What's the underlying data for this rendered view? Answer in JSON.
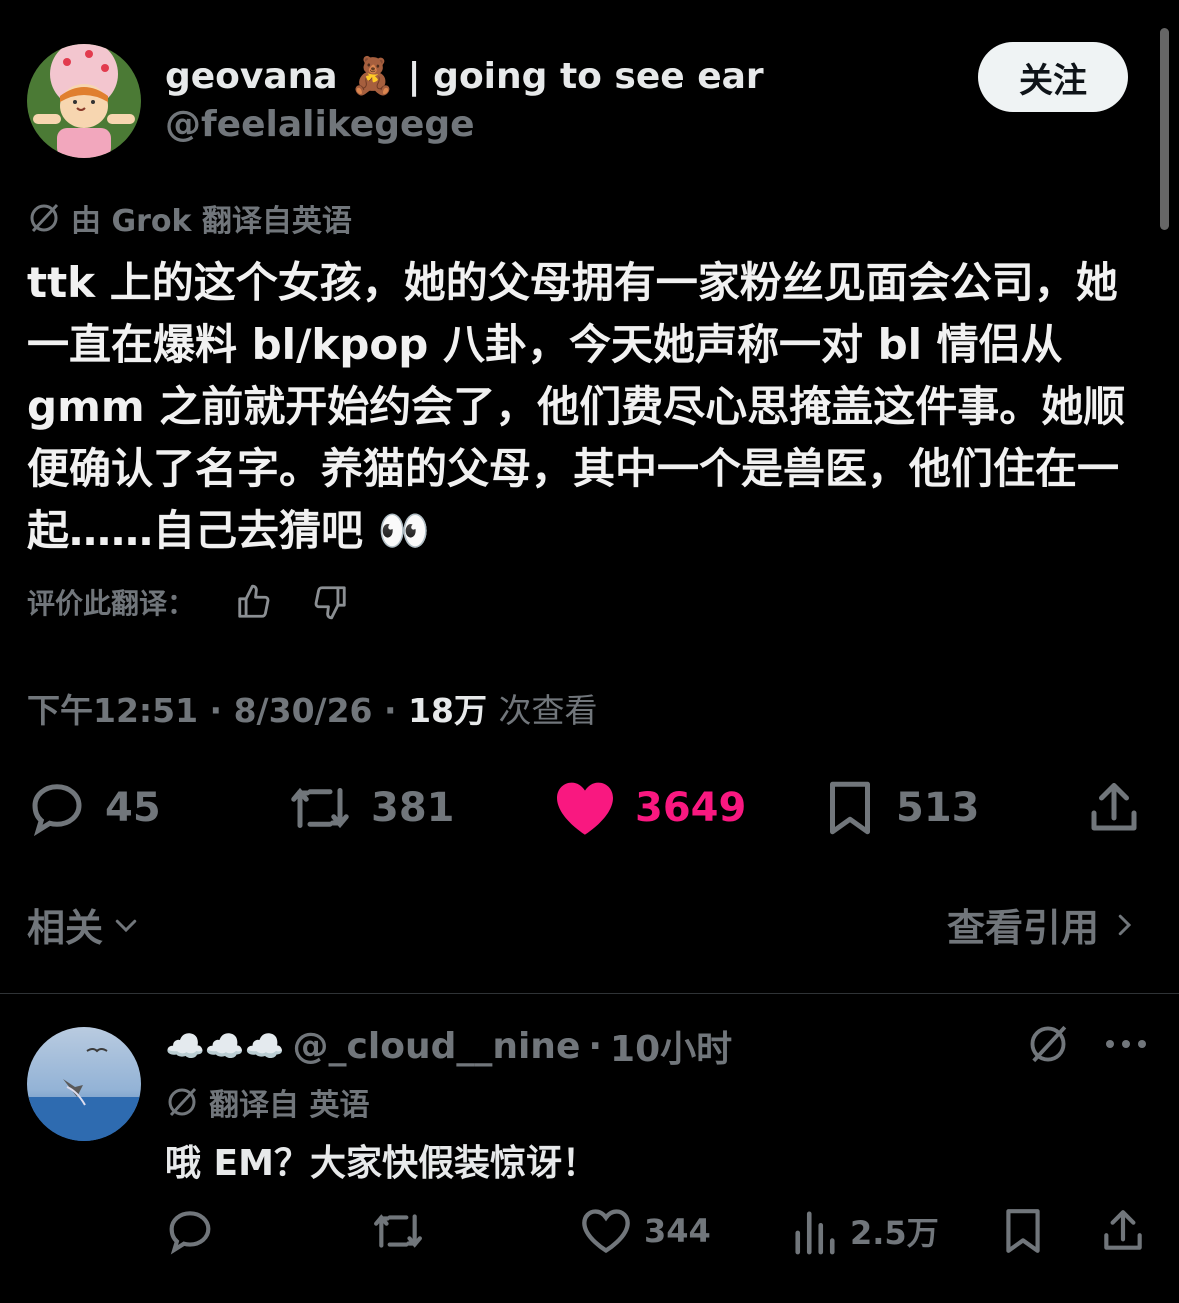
{
  "tweet": {
    "display_name": "geovana 🧸 | going to see ear",
    "handle": "@feelalikegege",
    "follow_label": "关注",
    "translation_note": "由 Grok 翻译自英语",
    "body": "ttk 上的这个女孩，她的父母拥有一家粉丝见面会公司，她一直在爆料 bl/kpop 八卦，今天她声称一对 bl 情侣从 gmm 之前就开始约会了，他们费尽心思掩盖这件事。她顺便确认了名字。养猫的父母，其中一个是兽医，他们住在一起……自己去猜吧 👀",
    "rate_label": "评价此翻译：",
    "time": "下午12:51",
    "date": "8/30/26",
    "views_count": "18万",
    "views_label": "次查看",
    "separator": "·",
    "stats": {
      "replies": "45",
      "retweets": "381",
      "likes": "3649",
      "bookmarks": "513"
    },
    "liked_color": "#f91880"
  },
  "related_label": "相关",
  "view_quotes_label": "查看引用",
  "reply": {
    "display_name": "☁️☁️☁️",
    "handle": "@_cloud__nine",
    "separator": "·",
    "time": "10小时",
    "translation_note": "翻译自 英语",
    "text": "哦 EM？大家快假装惊讶！",
    "likes": "344",
    "views": "2.5万"
  }
}
